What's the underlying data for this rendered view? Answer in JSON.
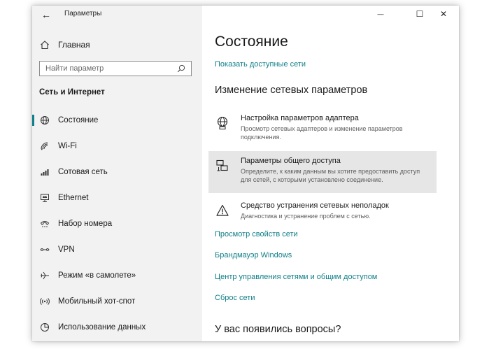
{
  "window": {
    "title": "Параметры",
    "back_glyph": "←",
    "minimize_glyph": "—",
    "maximize_glyph": "☐",
    "close_glyph": "✕"
  },
  "sidebar": {
    "home_label": "Главная",
    "search_placeholder": "Найти параметр",
    "section_title": "Сеть и Интернет",
    "items": [
      {
        "label": "Состояние",
        "icon": "globe-icon",
        "active": true
      },
      {
        "label": "Wi-Fi",
        "icon": "wifi-icon"
      },
      {
        "label": "Сотовая сеть",
        "icon": "cellular-icon"
      },
      {
        "label": "Ethernet",
        "icon": "ethernet-icon"
      },
      {
        "label": "Набор номера",
        "icon": "dialup-icon"
      },
      {
        "label": "VPN",
        "icon": "vpn-icon"
      },
      {
        "label": "Режим «в самолете»",
        "icon": "airplane-icon"
      },
      {
        "label": "Мобильный хот-спот",
        "icon": "hotspot-icon"
      },
      {
        "label": "Использование данных",
        "icon": "data-usage-icon"
      }
    ]
  },
  "main": {
    "title": "Состояние",
    "show_networks_link": "Показать доступные сети",
    "subheading": "Изменение сетевых параметров",
    "options": [
      {
        "title": "Настройка параметров адаптера",
        "desc": "Просмотр сетевых адаптеров и изменение параметров подключения.",
        "icon": "adapter-icon"
      },
      {
        "title": "Параметры общего доступа",
        "desc": "Определите, к каким данным вы хотите предоставить доступ для сетей, с которыми установлено соединение.",
        "icon": "sharing-icon",
        "highlighted": true
      },
      {
        "title": "Средство устранения сетевых неполадок",
        "desc": "Диагностика и устранение проблем с сетью.",
        "icon": "warning-icon"
      }
    ],
    "links": [
      "Просмотр свойств сети",
      "Брандмауэр Windows",
      "Центр управления сетями и общим доступом",
      "Сброс сети"
    ],
    "questions_heading": "У вас появились вопросы?"
  },
  "colors": {
    "accent": "#0f7f89",
    "sidebar_bg": "#f2f2f2",
    "highlight_bg": "#e6e6e6"
  }
}
